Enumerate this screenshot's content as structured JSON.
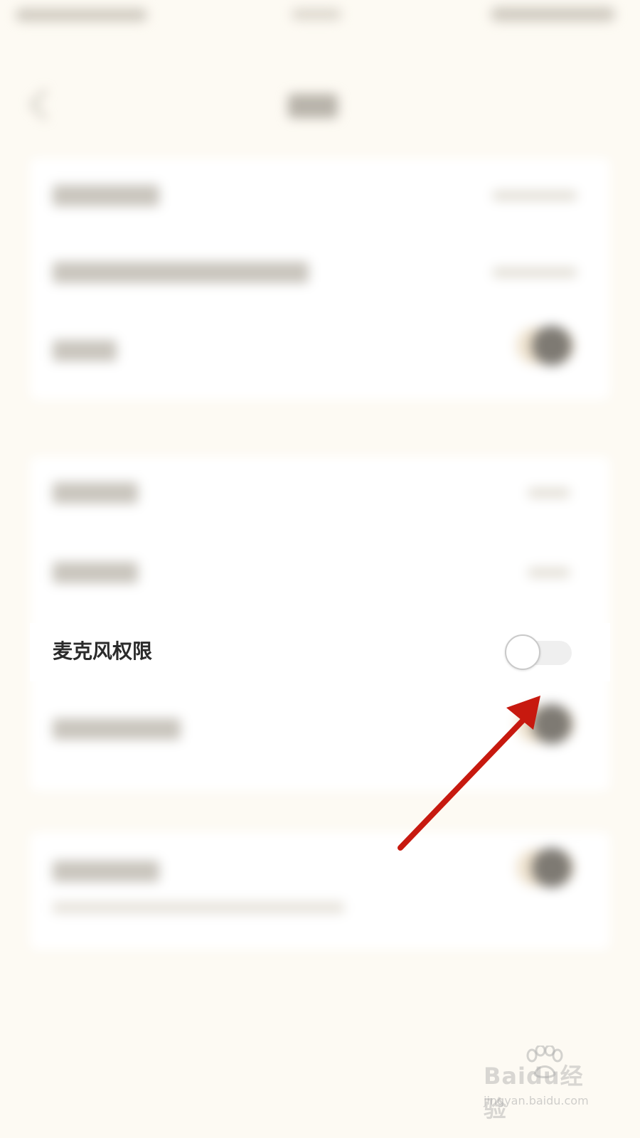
{
  "colors": {
    "page_background": "#fdfaf3",
    "card_background": "#ffffff",
    "label_text": "#2b2b2b",
    "toggle_track_off": "#efefef",
    "toggle_knob": "#ffffff",
    "annotation_arrow": "#c7190f"
  },
  "settings": {
    "microphone_permission": {
      "label": "麦克风权限",
      "toggle_state": "off"
    }
  },
  "annotation": {
    "type": "arrow",
    "points_to": "microphone_permission_toggle"
  },
  "watermark": {
    "brand": "Baidu经验",
    "url": "jingyan.baidu.com",
    "icon": "paw-icon"
  }
}
